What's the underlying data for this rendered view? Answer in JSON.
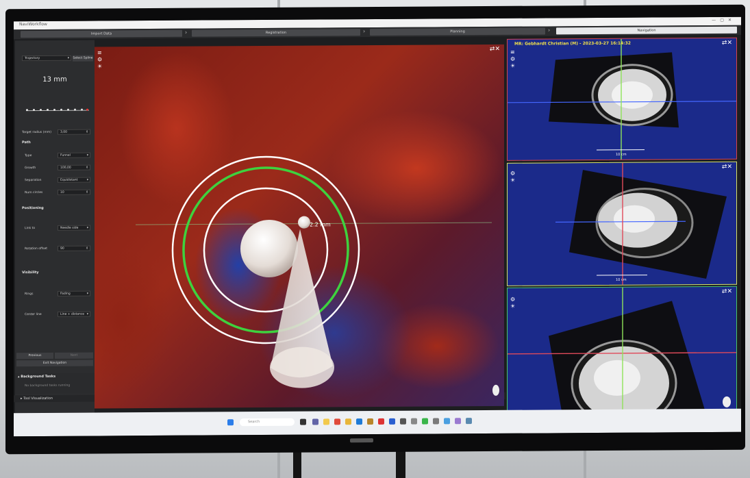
{
  "window": {
    "title": "NaviWorkflow"
  },
  "steps": [
    {
      "label": "Import Data",
      "active": false
    },
    {
      "label": "Registration",
      "active": false
    },
    {
      "label": "Planning",
      "active": false
    },
    {
      "label": "Navigation",
      "active": true
    }
  ],
  "left_panel": {
    "mode_dropdown": "Trajectory",
    "select_spline_button": "Select Spline",
    "distance_readout": "13 mm",
    "target_radius": {
      "label": "Target radius (mm)",
      "value": "3,00"
    },
    "path_header": "Path",
    "type": {
      "label": "Type",
      "value": "Funnel"
    },
    "growth": {
      "label": "Growth",
      "value": "100,00"
    },
    "separation": {
      "label": "Separation",
      "value": "Equidistant"
    },
    "num_circles": {
      "label": "Num circles",
      "value": "10"
    },
    "positioning_header": "Positioning",
    "link_to": {
      "label": "Link to",
      "value": "Needle side"
    },
    "rotation_offset": {
      "label": "Rotation offset",
      "value": "90"
    },
    "visibility_header": "Visibility",
    "rings": {
      "label": "Rings",
      "value": "Fading"
    },
    "center_line": {
      "label": "Center line",
      "value": "Line + distance"
    },
    "previous_button": "Previous",
    "next_button": "Next",
    "exit_button": "Exit Navigation",
    "background_tasks_header": "Background Tasks",
    "background_tasks_status": "No background tasks running",
    "tool_visualization": "Tool Visualization"
  },
  "view3d": {
    "distance_label": "2.2 mm"
  },
  "slices": {
    "patient_label": "MR: Gebhardt Christian (M) - 2023-03-27 16:14:32",
    "scale_label": "10 cm"
  },
  "taskbar": {
    "search_placeholder": "Search"
  },
  "colors": {
    "accent_green": "#3ed23e",
    "slice_bg": "#1b2a8a",
    "axial": "#d9444a",
    "sagittal": "#d8e266",
    "coronal": "#49c56b"
  }
}
